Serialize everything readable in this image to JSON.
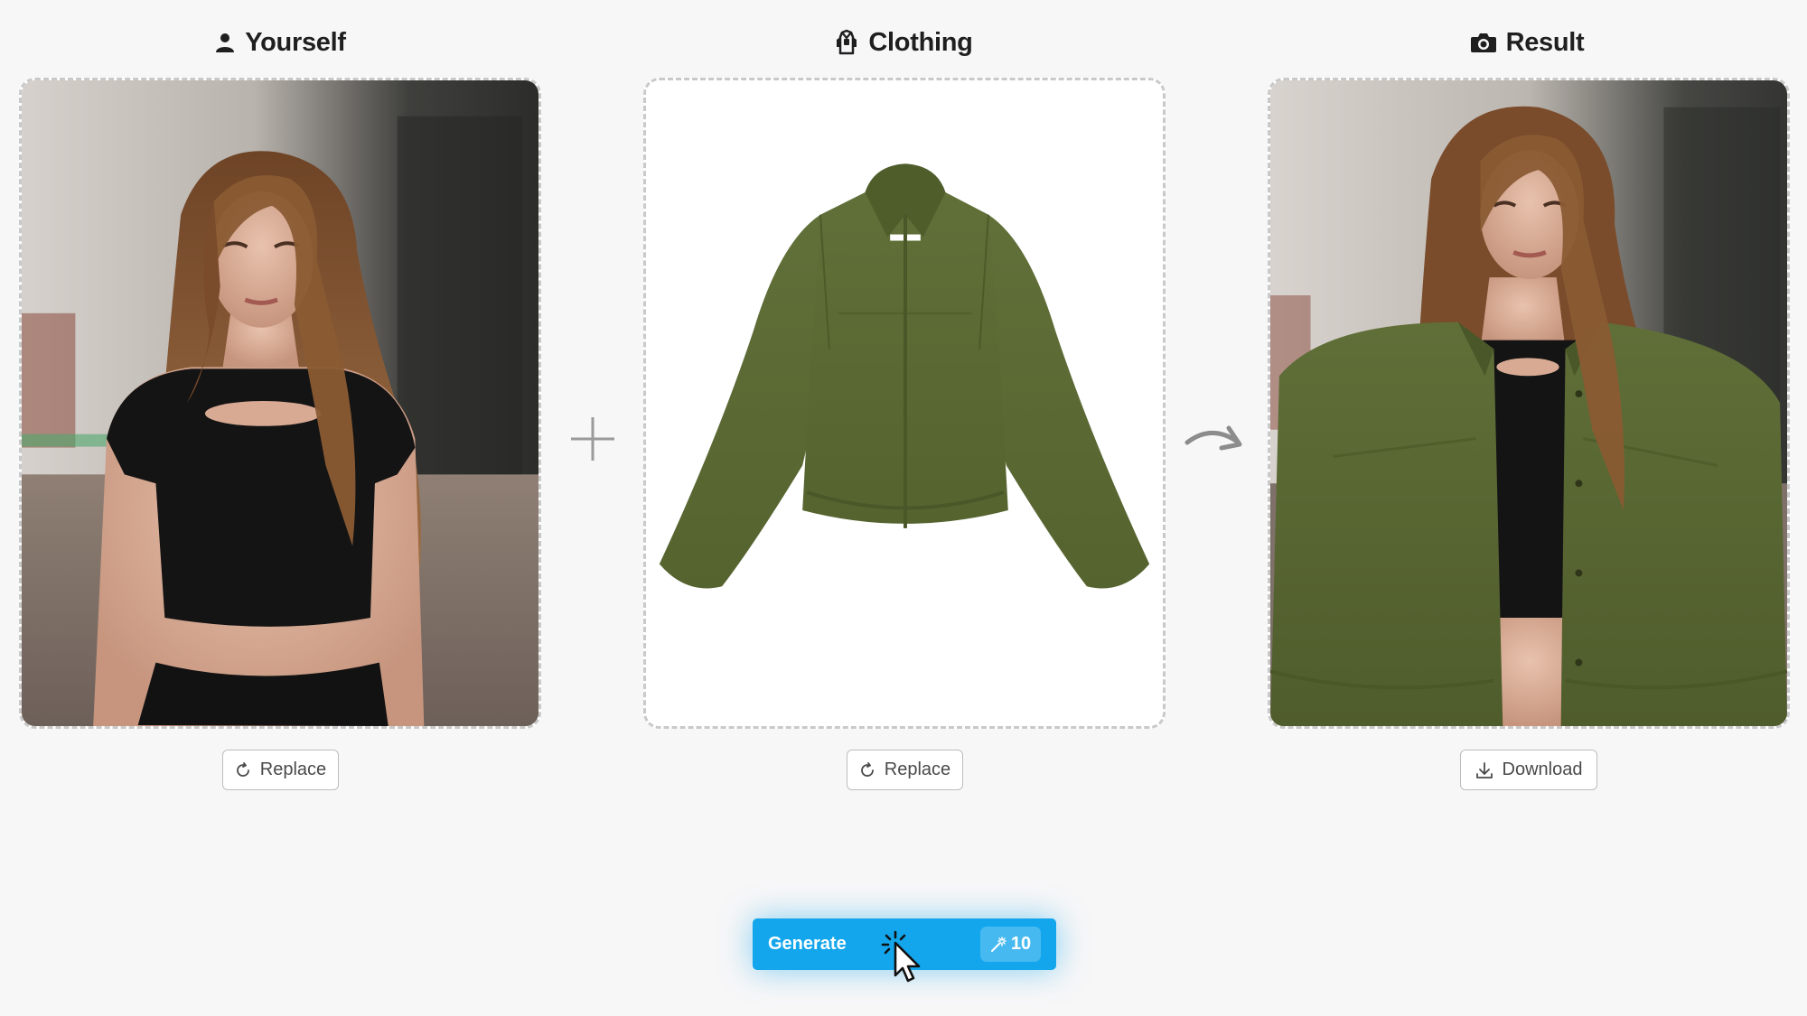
{
  "columns": {
    "yourself": {
      "title": "Yourself",
      "icon": "user-icon",
      "button": {
        "label": "Replace",
        "icon": "refresh-icon"
      }
    },
    "clothing": {
      "title": "Clothing",
      "icon": "clothing-icon",
      "button": {
        "label": "Replace",
        "icon": "refresh-icon"
      }
    },
    "result": {
      "title": "Result",
      "icon": "camera-icon",
      "button": {
        "label": "Download",
        "icon": "download-icon"
      }
    }
  },
  "operators": {
    "plus": "plus-icon",
    "arrow": "curved-arrow-icon"
  },
  "generate": {
    "label": "Generate",
    "credits": "10",
    "credits_icon": "magic-wand-icon"
  },
  "colors": {
    "accent": "#13a6ec",
    "jacket": "#5b6a35",
    "top": "#141414",
    "hair": "#8a5b33"
  }
}
